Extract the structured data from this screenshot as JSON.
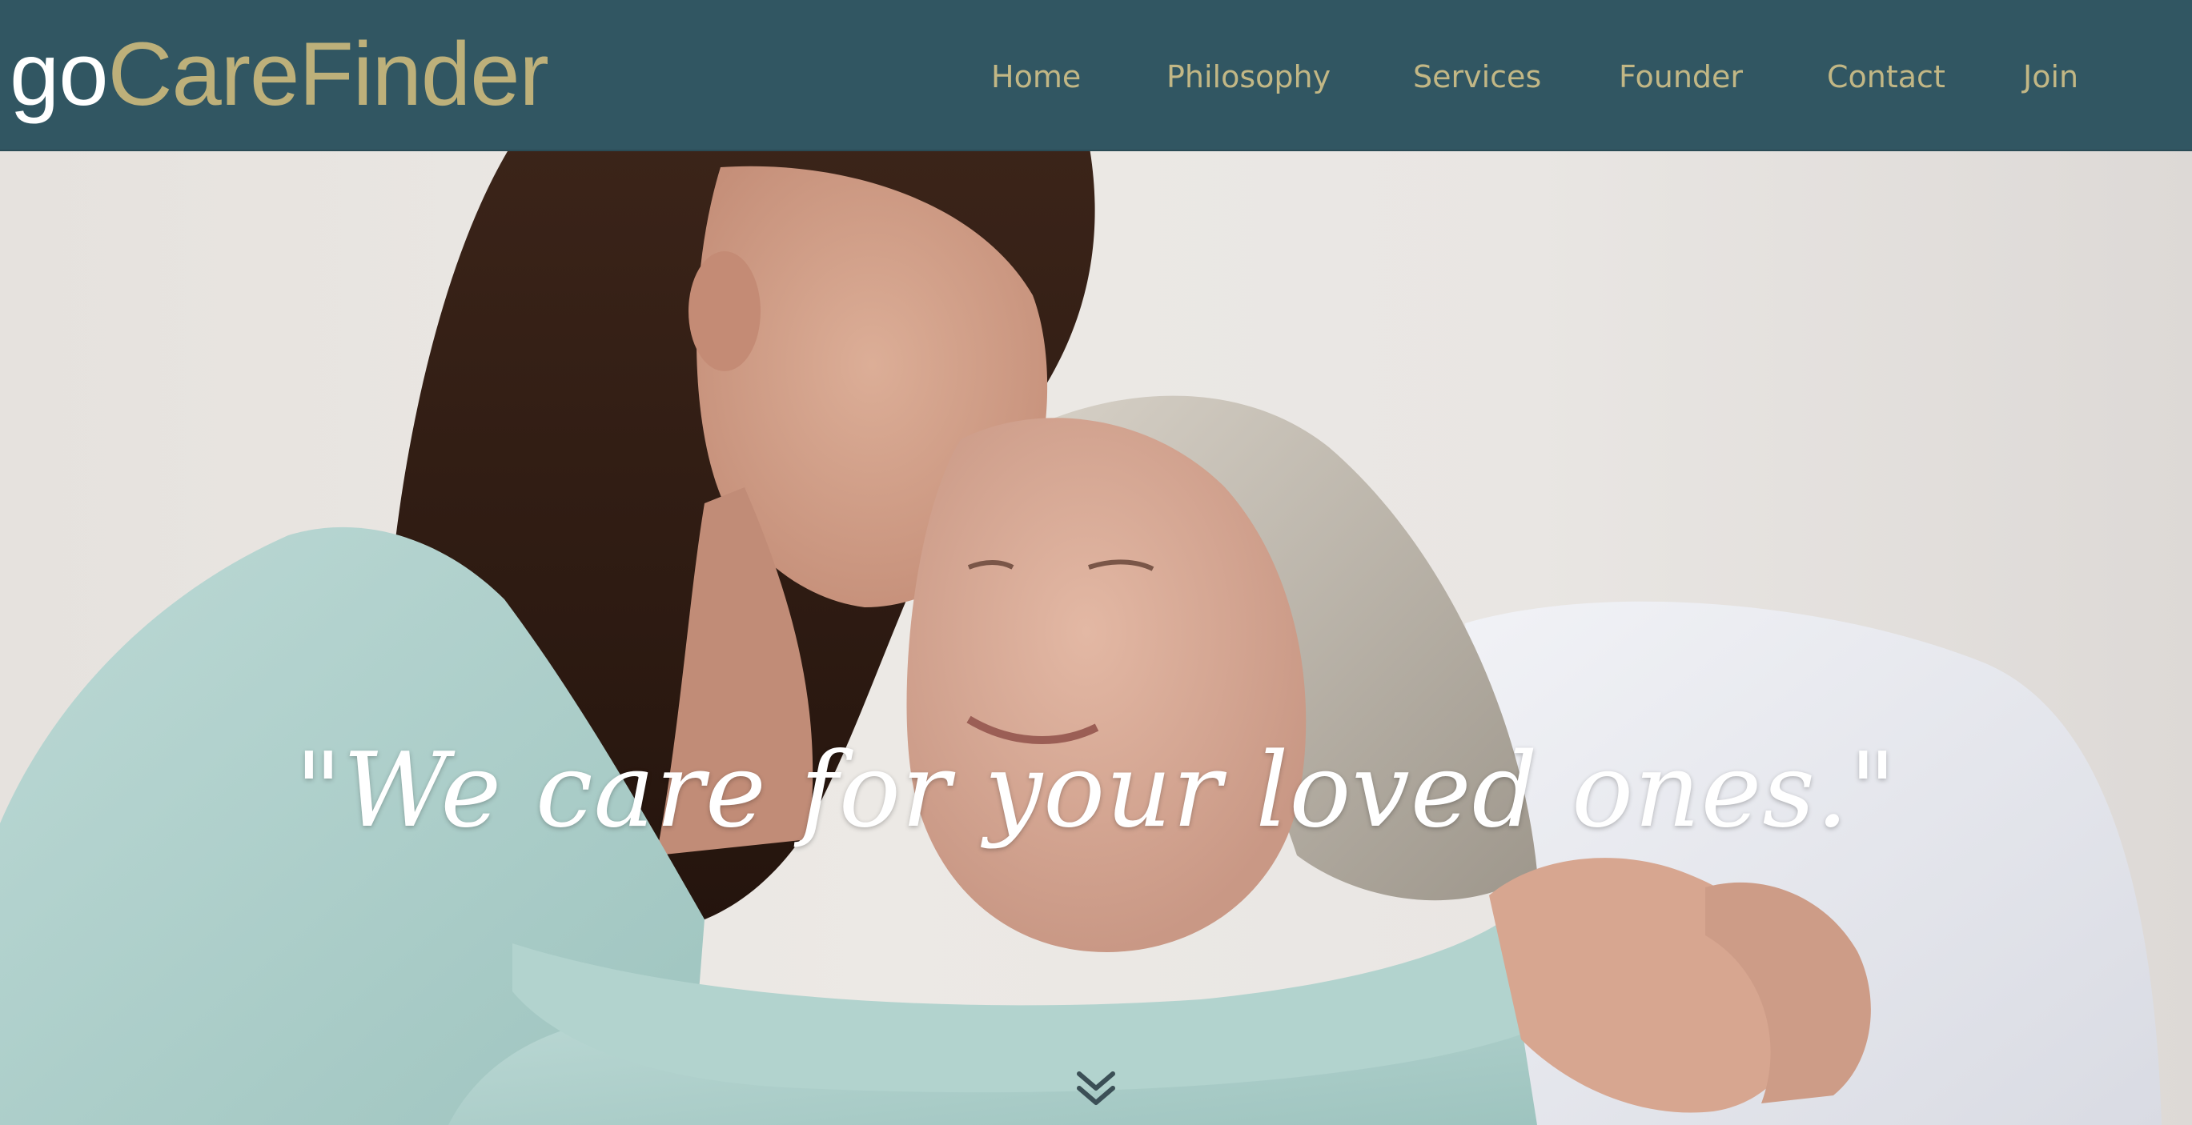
{
  "header": {
    "logo": {
      "prefix": "go",
      "brand": "CareFinder"
    },
    "nav": [
      {
        "label": "Home"
      },
      {
        "label": "Philosophy"
      },
      {
        "label": "Services"
      },
      {
        "label": "Founder"
      },
      {
        "label": "Contact"
      },
      {
        "label": "Join"
      }
    ]
  },
  "hero": {
    "tagline": "\"We care for your loved ones.\"",
    "scroll_icon": "double-chevron-down-icon"
  },
  "colors": {
    "header_bg": "#315662",
    "logo_accent": "#bdb07a",
    "nav_text": "#c2b785",
    "tagline_text": "#ffffff"
  }
}
